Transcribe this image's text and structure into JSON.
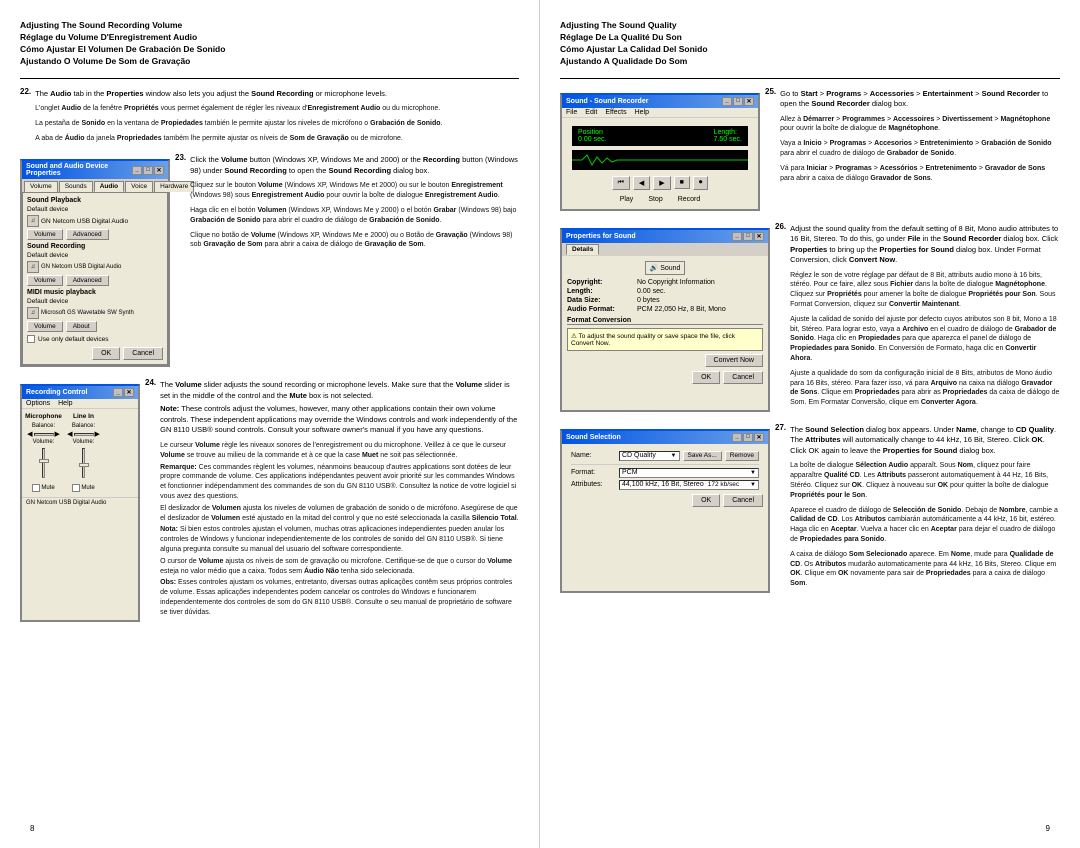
{
  "left_page": {
    "number": "8",
    "section_title": {
      "line1": "Adjusting The Sound Recording Volume",
      "line2": "Réglage du Volume D'Enregistrement Audio",
      "line3": "Cómo Ajustar El Volumen De Grabación De Sonido",
      "line4": "Ajustando O Volume De Som de Gravação"
    },
    "step22": {
      "number": "22.",
      "intro": "The Audio tab in the Properties window also lets you adjust the Sound Recording or microphone levels.",
      "fr": "L'onglet Audio de la fenêtre Propriétés vous permet également de régler les niveaux d'Enregistrement Audio ou du microphone.",
      "es": "La pestaña de Sonido en la ventana de Propiedades también le permite ajustar los niveles de micrófono o Grabación de Sonido.",
      "pt": "A aba de Áudio da janela Propriedades também lhe permite ajustar os níveis de Som de Gravação ou de microfone."
    },
    "step23": {
      "number": "23.",
      "intro_part1": "Click the Volume button (Windows XP, Windows Me and 2000) or the Recording button (Windows 98) under Sound Recording to open the Sound Recording dialog box.",
      "fr": "Cliquez sur le bouton Volume (Windows XP, Windows Me et 2000) ou sur le bouton Enregistrement (Windows 98) sous Enregistrement Audio pour ouvrir la boîte de dialogue Enregistrement Audio.",
      "es": "Haga clic en el botón Volumen (Windows XP, Windows Me y 2000) o el botón Grabar (Windows 98) bajo Grabación de Sonido para abrir el cuadro de diálogo de Grabación de Sonido.",
      "pt": "Clique no botão de Volume (Windows XP, Windows Me e 2000) ou o Botão de Gravação (Windows 98) sob Gravação de Som para abrir a caixa de diálogo de Gravação de Som."
    },
    "step24": {
      "number": "24.",
      "intro": "The Volume slider adjusts the sound recording or microphone levels. Make sure that the Volume slider is set in the middle of the control and the Mute box is not selected.",
      "note_label": "Note:",
      "note_text": "These controls adjust the volumes, however, many other applications contain their own volume controls. These independent applications may override the Windows controls and work independently of the GN 8110 USB® sound controls. Consult your software owner's manual if you have any questions.",
      "fr_label": "Le curseur",
      "fr": "Volume règle les niveaux sonores de l'enregistrement ou du microphone. Veillez à ce que le curseur Volume se trouve au milieu de la commande et à ce que la case Muet ne soit pas sélectionnée.",
      "fr_note_label": "Remarque:",
      "fr_note": "Ces commandes règlent les volumes, néanmoins beaucoup d'autres applications sont dotées de leur propre commande de volume. Ces applications indépendantes peuvent avoir priorité sur les commandes Windows et fonctionner indépendamment des commandes de son du GN 8110 USB®. Consultez la notice de votre logiciel si vous avez des questions.",
      "es": "El deslizador de Volumen ajusta los niveles de volumen de grabación de sonido o de micrófono. Asegúrese de que el deslizador de Volumen esté ajustado en la mitad del control y que no esté seleccionada la casilla Silencio Total.",
      "es_note_label": "Nota:",
      "es_note": "Si bien estos controles ajustan el volumen, muchas otras aplicaciones independientes pueden anular los controles de Windows y funcionar independientemente de los controles de sonido del GN 8110 USB®. Si tiene alguna pregunta consulte su manual del usuario del software correspondiente.",
      "pt": "O cursor de Volume ajusta os níveis de som de gravação ou microfone. Certifique-se de que o cursor do Volume esteja no valor médio que a caixa. Todos sem Áudio Não tenha sido selecionada.",
      "pt_note_label": "Obs:",
      "pt_note": "Esses controles ajustam os volumes, entretanto, diversas outras aplicações contêm seus próprios controles de volume. Essas aplicações independentes podem cancelar os controles do Windows e funcionarem independentemente dos controles de som do GN 8110 USB®. Consulte o seu manual de proprietário de software se tiver dúvidas."
    },
    "sound_audio_dialog": {
      "title": "Sound and Audio Device Properties",
      "tabs": [
        "Volume",
        "Sounds",
        "Audio",
        "Voice",
        "Hardware"
      ],
      "active_tab": "Audio",
      "sound_playback_label": "Sound Playback",
      "default_device": "Default device",
      "device1": "GN Netcom USB Digital Audio",
      "device2": "Default device",
      "device3": "Microsoft GS Wavetable SW Synth",
      "sound_recording_label": "Sound Recording",
      "midi_label": "MIDI music playback",
      "volume_btn": "Volume",
      "advanced_btn": "Advanced",
      "about_btn": "About",
      "checkbox_label": "Use only default devices",
      "ok_btn": "OK",
      "cancel_btn": "Cancel"
    },
    "volume_dialog": {
      "title": "Recording Control",
      "options": "Options  Help",
      "col1": "Microphone",
      "col2": "Line In",
      "balance_label": "Balance:",
      "volume_label": "Volume:",
      "mute_label": "Mute",
      "device_label": "GN Netcom USB Digital Audio"
    }
  },
  "right_page": {
    "number": "9",
    "section_title": {
      "line1": "Adjusting The Sound Quality",
      "line2": "Réglage De La Qualité Du Son",
      "line3": "Cómo Ajustar La Calidad Del Sonido",
      "line4": "Ajustando A Qualidade Do Som"
    },
    "step25": {
      "number": "25.",
      "intro": "Go to Start > Programs > Accessories > Entertainment > Sound Recorder to open the Sound Recorder dialog box.",
      "fr": "Allez à Démarrer > Programmes > Accessoires > Divertissement > Magnétophone pour ouvrir la boîte de dialogue de Magnétophone.",
      "es": "Vaya a Inicio > Programas > Accesorios > Entretenimiento > Grabación de Sonido para abrir el cuadro de diálogo de Grabador de Sonido.",
      "pt": "Vá para Iniciar > Programas > Acessórios > Entretenimento > Gravador de Sons para abrir a caixa de diálogo Gravador de Sons."
    },
    "step26": {
      "number": "26.",
      "intro_part1": "Adjust the sound quality from the default setting of 8 Bit, Mono audio attributes to 16 Bit, Stereo. To do this, go under File in the Sound Recorder dialog box. Click Properties to bring up the Properties for Sound dialog box. Under Format Conversion, click Convert Now.",
      "fr": "Réglez le son de votre réglage par défaut de 8 Bit, attributs audio mono à 16 bits, stéréo. Pour ce faire, allez sous Fichier dans la boîte de dialogue Magnétophone. Cliquez sur Propriétés pour amener la boîte de dialogue Propriétés pour Son. Sous Format Conversion, cliquez sur Convertir Maintenant.",
      "es": "Ajuste la calidad de sonido del ajuste por defecto cuyos atributos son 8 bit, Mono a 18 bit, Stéreo. Para lograr esto, vaya a Archivo en el cuadro de diálogo de Grabador de Sonido. Haga clic en Propiedades para que aparezca el panel de diálogo de Propiedades para Sonido. En Conversión de Formato, haga clic en Convertir Ahora.",
      "pt": "Ajuste a qualidade do som da configuração inicial de 8 Bits, atributos de Mono áudio para 16 Bits, stéreo. Para fazer isso, vá para Arquivo na caixa na diálogo Gravador de Sons. Clique em Propriedades para abrir as Propriedades da caixa de diálogo de Som. Em Formatar Conversão, clique em Converter Agora."
    },
    "step27": {
      "number": "27.",
      "intro": "The Sound Selection dialog box appears. Under Name, change to CD Quality. The Attributes will automatically change to 44 kHz, 16 Bit, Stereo. Click OK. Click OK again to leave the Properties for Sound dialog box.",
      "fr": "La boîte de dialogue Sélection Audio apparaît. Sous Nom, cliquez pour faire apparaître Qualité CD. Les Attributs passeront automatiquement à 44 Hz, 16 Bits, Stéréo. Cliquez sur OK. Cliquez à nouveau sur OK pour quitter la boîte de dialogue Propriétés pour le Son.",
      "es": "Aparece el cuadro de diálogo de Selección de Sonido. Debajo de Nombre, cambie a Calidad de CD. Los Atributos cambiarán automáticamente a 44 kHz, 16 bit, estéreo. Haga clic en Aceptar. Vuelva a hacer clic en Aceptar para dejar el cuadro de diálogo de Propiedades para Sonido.",
      "pt": "A caixa de diálogo Som Selecionado aparece. Em Nome, mude para Qualidade de CD. Os Atributos mudarão automaticamente para 44 kHz, 16 Bits, Stereo. Clique em OK. Clique em OK novamente para sair de Propriedades para a caixa de diálogo Som."
    },
    "sound_recorder_dialog": {
      "title": "Sound - Sound Recorder",
      "menu": [
        "File",
        "Edit",
        "Effects",
        "Help"
      ],
      "position_label": "Position",
      "position_value": "0.00 sec.",
      "length_label": "Length:",
      "length_value": "7.50 sec.",
      "play_btn": "Play",
      "stop_btn": "Stop",
      "record_btn": "Record"
    },
    "properties_dialog": {
      "title": "Properties for Sound",
      "details_tab": "Details",
      "sound_label": "Sound",
      "copyright_label": "Copyright:",
      "copyright_value": "No Copyright Information",
      "length_label": "Length:",
      "length_value": "0.00 sec.",
      "data_size_label": "Data Size:",
      "data_size_value": "0 bytes",
      "audio_format_label": "Audio Format:",
      "audio_format_value": "PCM 22,050 Hz, 8 Bit, Mono",
      "format_conversion_label": "Format Conversion",
      "conversion_note": "To adjust the sound quality or save space the file, click Convert Now.",
      "convert_btn": "Convert Now",
      "ok_btn": "OK",
      "cancel_btn": "Cancel"
    },
    "sound_selection_dialog": {
      "title": "Sound Selection",
      "name_label": "Name:",
      "name_value": "CD Quality",
      "save_as_btn": "Save As...",
      "remove_btn": "Remove",
      "format_label": "Format:",
      "format_value": "PCM",
      "attributes_label": "Attributes:",
      "attributes_value": "44,100 kHz, 16 Bit, Stereo",
      "attributes_size": "172 kb/sec",
      "ok_btn": "OK",
      "cancel_btn": "Cancel"
    }
  }
}
